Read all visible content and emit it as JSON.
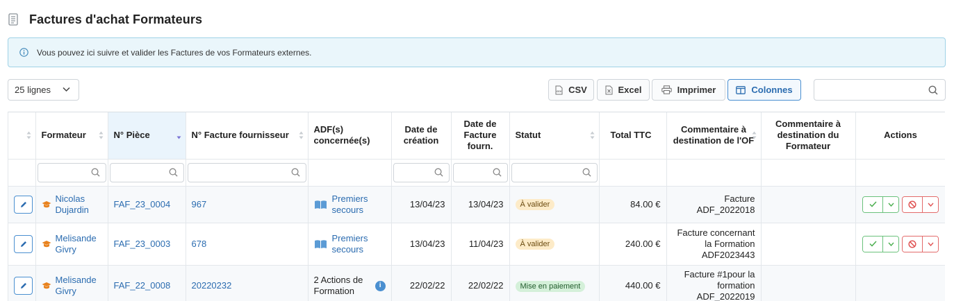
{
  "page": {
    "title": "Factures d'achat Formateurs",
    "info": "Vous pouvez ici suivre et valider les Factures de vos Formateurs externes."
  },
  "toolbar": {
    "lines_selected": "25 lignes",
    "csv_label": "CSV",
    "excel_label": "Excel",
    "print_label": "Imprimer",
    "columns_label": "Colonnes",
    "search_value": ""
  },
  "table": {
    "columns": {
      "formateur": "Formateur",
      "piece": "N° Pièce",
      "facture": "N° Facture fournisseur",
      "adf": "ADF(s) concernée(s)",
      "creation": "Date de création",
      "date_fourn": "Date de Facture fourn.",
      "statut": "Statut",
      "total": "Total TTC",
      "comment_of": "Commentaire à destination de l'OF",
      "comment_form": "Commentaire à destination du Formateur",
      "actions": "Actions"
    },
    "rows": [
      {
        "formateur": "Nicolas Dujardin",
        "piece": "FAF_23_0004",
        "facture": "967",
        "adf": "Premiers secours",
        "creation": "13/04/23",
        "date_fourn": "13/04/23",
        "statut": "À valider",
        "total": "84.00 €",
        "comment_of": "Facture ADF_2022018",
        "comment_form": ""
      },
      {
        "formateur": "Melisande Givry",
        "piece": "FAF_23_0003",
        "facture": "678",
        "adf": "Premiers secours",
        "creation": "13/04/23",
        "date_fourn": "11/04/23",
        "statut": "À valider",
        "total": "240.00 €",
        "comment_of": "Facture concernant la Formation ADF2023443",
        "comment_form": ""
      },
      {
        "formateur": "Melisande Givry",
        "piece": "FAF_22_0008",
        "facture": "20220232",
        "adf": "2 Actions de Formation",
        "creation": "22/02/22",
        "date_fourn": "22/02/22",
        "statut": "Mise en paiement",
        "total": "440.00 €",
        "comment_of": "Facture #1pour la formation ADF_2022019",
        "comment_form": ""
      }
    ]
  },
  "icons": {
    "header": "document-icon",
    "info": "info-icon",
    "csv": "csv-file-icon",
    "excel": "excel-file-icon",
    "print": "printer-icon",
    "columns": "columns-icon",
    "search": "search-icon",
    "edit": "pencil-icon",
    "trainer": "graduation-cap-icon",
    "adf": "book-icon",
    "validate": "check-icon",
    "refuse": "forbidden-icon"
  },
  "colors": {
    "accent": "#2b6cb0",
    "info_bg": "#eaf6fb",
    "badge_wait": "#fdebc8",
    "badge_pay": "#d4f0d9",
    "ok": "#4caf50",
    "ko": "#e05555",
    "trainer_icon": "#e8821e"
  }
}
